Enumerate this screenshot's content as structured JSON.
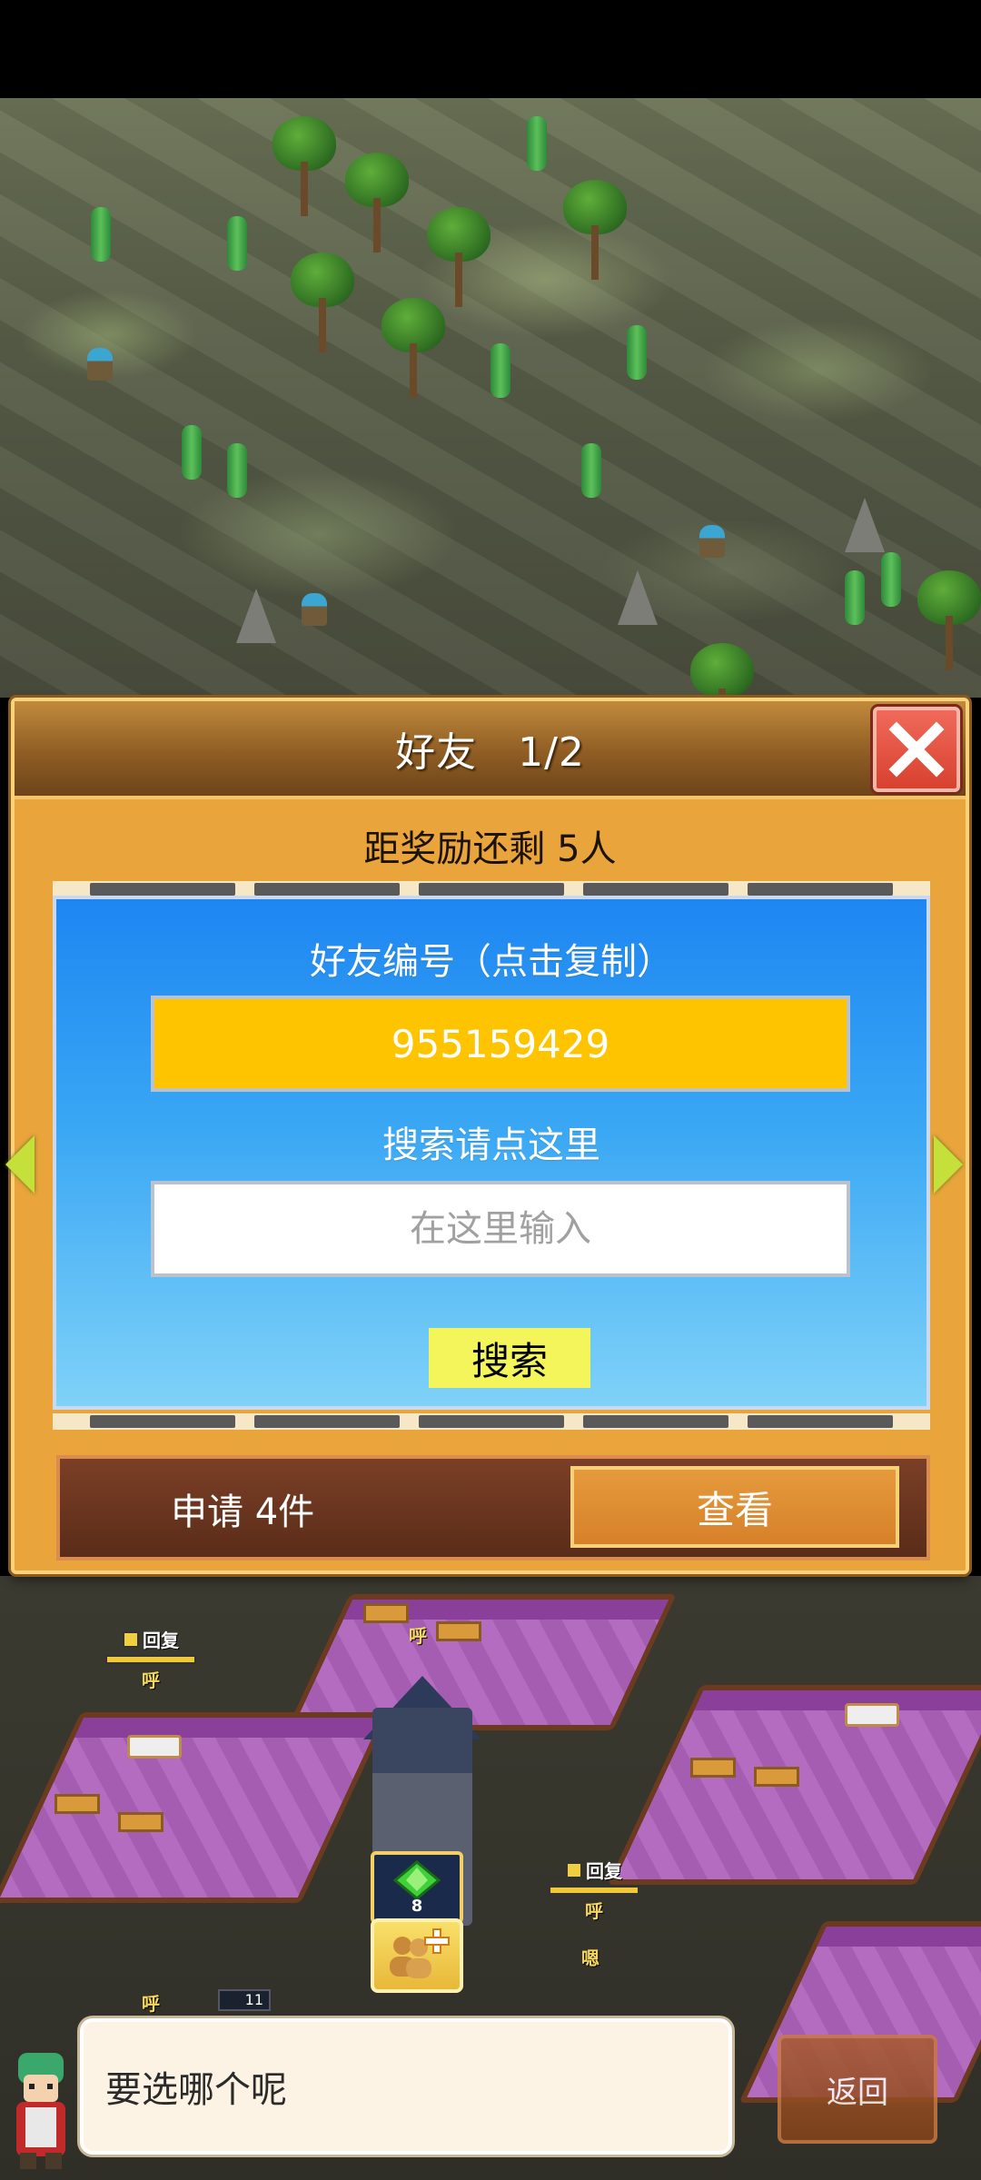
{
  "dialog": {
    "title": "好友　1/2",
    "reward_text": "距奖励还剩 5人",
    "friend_id_label": "好友编号（点击复制）",
    "friend_id": "955159429",
    "search_label": "搜索请点这里",
    "search_placeholder": "在这里输入",
    "search_button": "搜索",
    "requests_text": "申请 4件",
    "view_button": "查看"
  },
  "world": {
    "status_tags": [
      {
        "label": "回复",
        "sub": "呼"
      },
      {
        "label": "回复",
        "sub": "呼"
      }
    ],
    "float_words": [
      "呼",
      "呼",
      "嗯"
    ],
    "gem_count": "8",
    "level_value": "11"
  },
  "footer": {
    "message": "要选哪个呢",
    "back_button": "返回"
  },
  "colors": {
    "dialog_bg": "#e9a43c",
    "panel_blue": "#1e86f2",
    "id_yellow": "#ffc400",
    "search_button_bg": "#f3f55a",
    "close_red": "#d8412f",
    "view_orange": "#d6812a"
  },
  "icons": {
    "close": "close-x-icon",
    "prev": "arrow-left-icon",
    "next": "arrow-right-icon",
    "gem": "green-gem-icon",
    "friend_add": "friends-add-icon"
  }
}
